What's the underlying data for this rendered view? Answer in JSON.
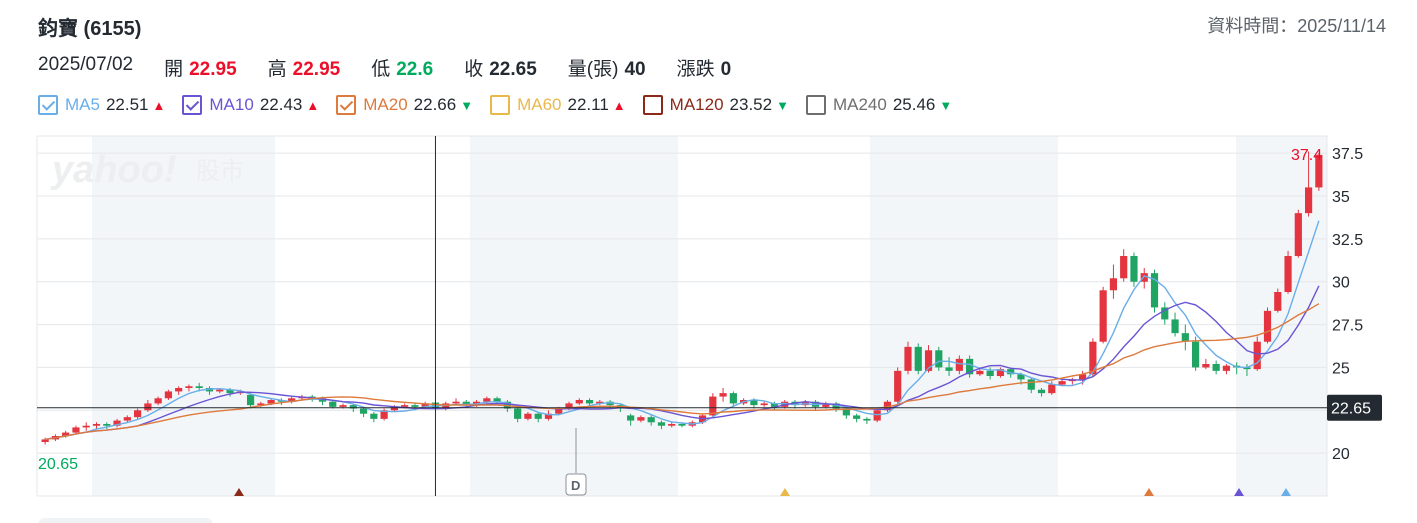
{
  "header": {
    "title": "鈞寶 (6155)",
    "data_time": "資料時間：2025/11/14"
  },
  "ohlc": {
    "date": "2025/07/02",
    "open_label": "開",
    "open": "22.95",
    "high_label": "高",
    "high": "22.95",
    "low_label": "低",
    "low": "22.6",
    "close_label": "收",
    "close": "22.65",
    "volume_label": "量(張)",
    "volume": "40",
    "change_label": "漲跌",
    "change": "0"
  },
  "legend": [
    {
      "name": "MA5",
      "value": "22.51",
      "dir": "up",
      "color": "#6aaee8",
      "checked": true
    },
    {
      "name": "MA10",
      "value": "22.43",
      "dir": "up",
      "color": "#6a54d4",
      "checked": true
    },
    {
      "name": "MA20",
      "value": "22.66",
      "dir": "down",
      "color": "#dd7a3c",
      "checked": true
    },
    {
      "name": "MA60",
      "value": "22.11",
      "dir": "up",
      "color": "#e8b84a",
      "checked": false
    },
    {
      "name": "MA120",
      "value": "23.52",
      "dir": "down",
      "color": "#8b2a1a",
      "checked": false
    },
    {
      "name": "MA240",
      "value": "25.46",
      "dir": "down",
      "color": "#6e6e6e",
      "checked": false
    }
  ],
  "arrows": {
    "up": "▲",
    "down": "▼"
  },
  "watermark": {
    "brand": "yahoo!",
    "suffix": "股市"
  },
  "chart_data": {
    "type": "candlestick",
    "y_ticks": [
      "20",
      "22.5",
      "25",
      "27.5",
      "30",
      "32.5",
      "35",
      "37.5"
    ],
    "ylim": [
      17.5,
      38.5
    ],
    "max_label": "37.4",
    "min_label": "20.65",
    "crosshair_value": "22.65",
    "crosshair_y": 22.65,
    "divider_marker": "D",
    "colors": {
      "up": "#e3343f",
      "down": "#1fa463",
      "grid": "#e4e7ea",
      "band": "#f3f6f9"
    },
    "candles": [
      [
        20.65,
        20.8,
        20.5,
        20.9
      ],
      [
        20.8,
        21.0,
        20.7,
        21.1
      ],
      [
        21.0,
        21.2,
        20.9,
        21.3
      ],
      [
        21.2,
        21.5,
        21.1,
        21.6
      ],
      [
        21.5,
        21.6,
        21.3,
        21.8
      ],
      [
        21.6,
        21.7,
        21.4,
        21.8
      ],
      [
        21.7,
        21.6,
        21.4,
        21.8
      ],
      [
        21.6,
        21.9,
        21.5,
        22.0
      ],
      [
        21.9,
        22.1,
        21.8,
        22.2
      ],
      [
        22.1,
        22.5,
        22.0,
        22.6
      ],
      [
        22.5,
        22.9,
        22.4,
        23.1
      ],
      [
        22.9,
        23.2,
        22.8,
        23.3
      ],
      [
        23.2,
        23.6,
        23.1,
        23.7
      ],
      [
        23.6,
        23.8,
        23.4,
        23.9
      ],
      [
        23.8,
        23.9,
        23.6,
        24.0
      ],
      [
        23.9,
        23.8,
        23.6,
        24.1
      ],
      [
        23.8,
        23.6,
        23.4,
        23.9
      ],
      [
        23.6,
        23.7,
        23.5,
        23.8
      ],
      [
        23.7,
        23.5,
        23.3,
        23.8
      ],
      [
        23.5,
        23.6,
        23.4,
        23.7
      ],
      [
        23.4,
        22.8,
        22.6,
        23.5
      ],
      [
        22.8,
        22.9,
        22.7,
        23.0
      ],
      [
        22.9,
        23.1,
        22.8,
        23.2
      ],
      [
        23.1,
        23.0,
        22.8,
        23.2
      ],
      [
        23.0,
        23.2,
        22.9,
        23.3
      ],
      [
        23.2,
        23.3,
        23.1,
        23.4
      ],
      [
        23.3,
        23.2,
        23.0,
        23.4
      ],
      [
        23.2,
        23.0,
        22.8,
        23.3
      ],
      [
        23.0,
        22.7,
        22.6,
        23.1
      ],
      [
        22.7,
        22.8,
        22.6,
        22.9
      ],
      [
        22.8,
        22.6,
        22.4,
        22.9
      ],
      [
        22.6,
        22.3,
        22.1,
        22.7
      ],
      [
        22.3,
        22.0,
        21.8,
        22.4
      ],
      [
        22.0,
        22.5,
        21.9,
        22.6
      ],
      [
        22.5,
        22.7,
        22.4,
        22.8
      ],
      [
        22.7,
        22.8,
        22.6,
        22.9
      ],
      [
        22.8,
        22.7,
        22.5,
        22.9
      ],
      [
        22.7,
        22.9,
        22.6,
        23.0
      ],
      [
        22.95,
        22.65,
        22.6,
        22.95
      ],
      [
        22.65,
        22.9,
        22.5,
        23.0
      ],
      [
        22.9,
        23.0,
        22.8,
        23.2
      ],
      [
        23.0,
        22.8,
        22.7,
        23.1
      ],
      [
        22.8,
        23.0,
        22.7,
        23.1
      ],
      [
        23.0,
        23.2,
        22.9,
        23.3
      ],
      [
        23.2,
        23.0,
        22.8,
        23.3
      ],
      [
        23.0,
        22.6,
        22.4,
        23.1
      ],
      [
        22.6,
        22.0,
        21.8,
        22.7
      ],
      [
        22.0,
        22.3,
        21.9,
        22.4
      ],
      [
        22.3,
        22.0,
        21.8,
        22.4
      ],
      [
        22.0,
        22.3,
        21.9,
        22.5
      ],
      [
        22.3,
        22.6,
        22.2,
        22.7
      ],
      [
        22.6,
        22.9,
        22.5,
        23.0
      ],
      [
        22.9,
        23.1,
        22.8,
        23.2
      ],
      [
        23.1,
        22.9,
        22.7,
        23.2
      ],
      [
        22.9,
        23.0,
        22.8,
        23.1
      ],
      [
        23.0,
        22.8,
        22.6,
        23.1
      ],
      [
        22.8,
        22.6,
        22.4,
        22.9
      ],
      [
        22.2,
        21.9,
        21.6,
        22.3
      ],
      [
        21.9,
        22.1,
        21.8,
        22.2
      ],
      [
        22.1,
        21.8,
        21.6,
        22.2
      ],
      [
        21.8,
        21.6,
        21.4,
        21.9
      ],
      [
        21.6,
        21.7,
        21.5,
        21.8
      ],
      [
        21.7,
        21.6,
        21.5,
        21.8
      ],
      [
        21.6,
        21.8,
        21.5,
        21.9
      ],
      [
        21.8,
        22.2,
        21.7,
        22.3
      ],
      [
        22.2,
        23.3,
        22.1,
        23.5
      ],
      [
        23.3,
        23.5,
        23.0,
        23.8
      ],
      [
        23.5,
        22.9,
        22.7,
        23.6
      ],
      [
        22.9,
        23.1,
        22.8,
        23.2
      ],
      [
        23.1,
        22.8,
        22.6,
        23.2
      ],
      [
        22.8,
        22.9,
        22.7,
        23.0
      ],
      [
        22.9,
        22.7,
        22.5,
        23.0
      ],
      [
        22.7,
        23.0,
        22.6,
        23.1
      ],
      [
        23.0,
        22.8,
        22.6,
        23.1
      ],
      [
        22.8,
        23.0,
        22.7,
        23.1
      ],
      [
        23.0,
        22.7,
        22.5,
        23.1
      ],
      [
        22.7,
        22.9,
        22.6,
        23.0
      ],
      [
        22.9,
        22.6,
        22.4,
        23.0
      ],
      [
        22.6,
        22.2,
        22.0,
        22.7
      ],
      [
        22.2,
        22.0,
        21.8,
        22.3
      ],
      [
        22.0,
        21.9,
        21.7,
        22.1
      ],
      [
        21.9,
        22.5,
        21.8,
        22.6
      ],
      [
        22.5,
        23.0,
        22.4,
        23.1
      ],
      [
        23.0,
        24.8,
        22.9,
        25.0
      ],
      [
        24.8,
        26.2,
        24.6,
        26.5
      ],
      [
        26.2,
        24.8,
        24.6,
        26.4
      ],
      [
        24.8,
        26.0,
        24.7,
        26.3
      ],
      [
        26.0,
        25.0,
        24.8,
        26.2
      ],
      [
        25.0,
        24.8,
        24.5,
        25.6
      ],
      [
        24.8,
        25.5,
        24.6,
        25.7
      ],
      [
        25.5,
        24.6,
        24.4,
        25.7
      ],
      [
        24.6,
        24.8,
        24.5,
        25.0
      ],
      [
        24.8,
        24.5,
        24.3,
        25.0
      ],
      [
        24.5,
        24.9,
        24.4,
        25.0
      ],
      [
        24.9,
        24.6,
        24.4,
        25.0
      ],
      [
        24.6,
        24.3,
        24.0,
        24.7
      ],
      [
        24.3,
        23.7,
        23.5,
        24.4
      ],
      [
        23.7,
        23.5,
        23.3,
        23.8
      ],
      [
        23.5,
        24.0,
        23.4,
        24.2
      ],
      [
        24.0,
        24.2,
        23.9,
        24.3
      ],
      [
        24.2,
        24.3,
        24.0,
        24.4
      ],
      [
        24.3,
        24.6,
        24.0,
        24.8
      ],
      [
        24.6,
        26.5,
        24.5,
        26.7
      ],
      [
        26.5,
        29.5,
        26.4,
        29.7
      ],
      [
        29.5,
        30.2,
        29.0,
        31.0
      ],
      [
        30.2,
        31.5,
        30.0,
        31.9
      ],
      [
        31.5,
        30.0,
        29.7,
        31.7
      ],
      [
        30.0,
        30.5,
        29.6,
        30.8
      ],
      [
        30.5,
        28.5,
        28.2,
        30.7
      ],
      [
        28.5,
        27.8,
        27.5,
        28.8
      ],
      [
        27.8,
        27.0,
        26.8,
        28.2
      ],
      [
        27.0,
        26.5,
        26.0,
        27.5
      ],
      [
        26.5,
        25.0,
        24.8,
        26.8
      ],
      [
        25.0,
        25.2,
        24.9,
        25.5
      ],
      [
        25.2,
        24.8,
        24.6,
        25.4
      ],
      [
        24.8,
        25.1,
        24.6,
        25.2
      ],
      [
        25.1,
        25.0,
        24.6,
        25.3
      ],
      [
        25.0,
        24.9,
        24.5,
        25.2
      ],
      [
        24.9,
        26.5,
        24.8,
        26.8
      ],
      [
        26.5,
        28.3,
        26.4,
        28.5
      ],
      [
        28.3,
        29.4,
        28.2,
        29.6
      ],
      [
        29.4,
        31.5,
        29.3,
        31.8
      ],
      [
        31.5,
        34.0,
        31.4,
        34.2
      ],
      [
        34.0,
        35.5,
        33.8,
        37.6
      ],
      [
        35.5,
        37.4,
        35.3,
        37.5
      ]
    ]
  }
}
